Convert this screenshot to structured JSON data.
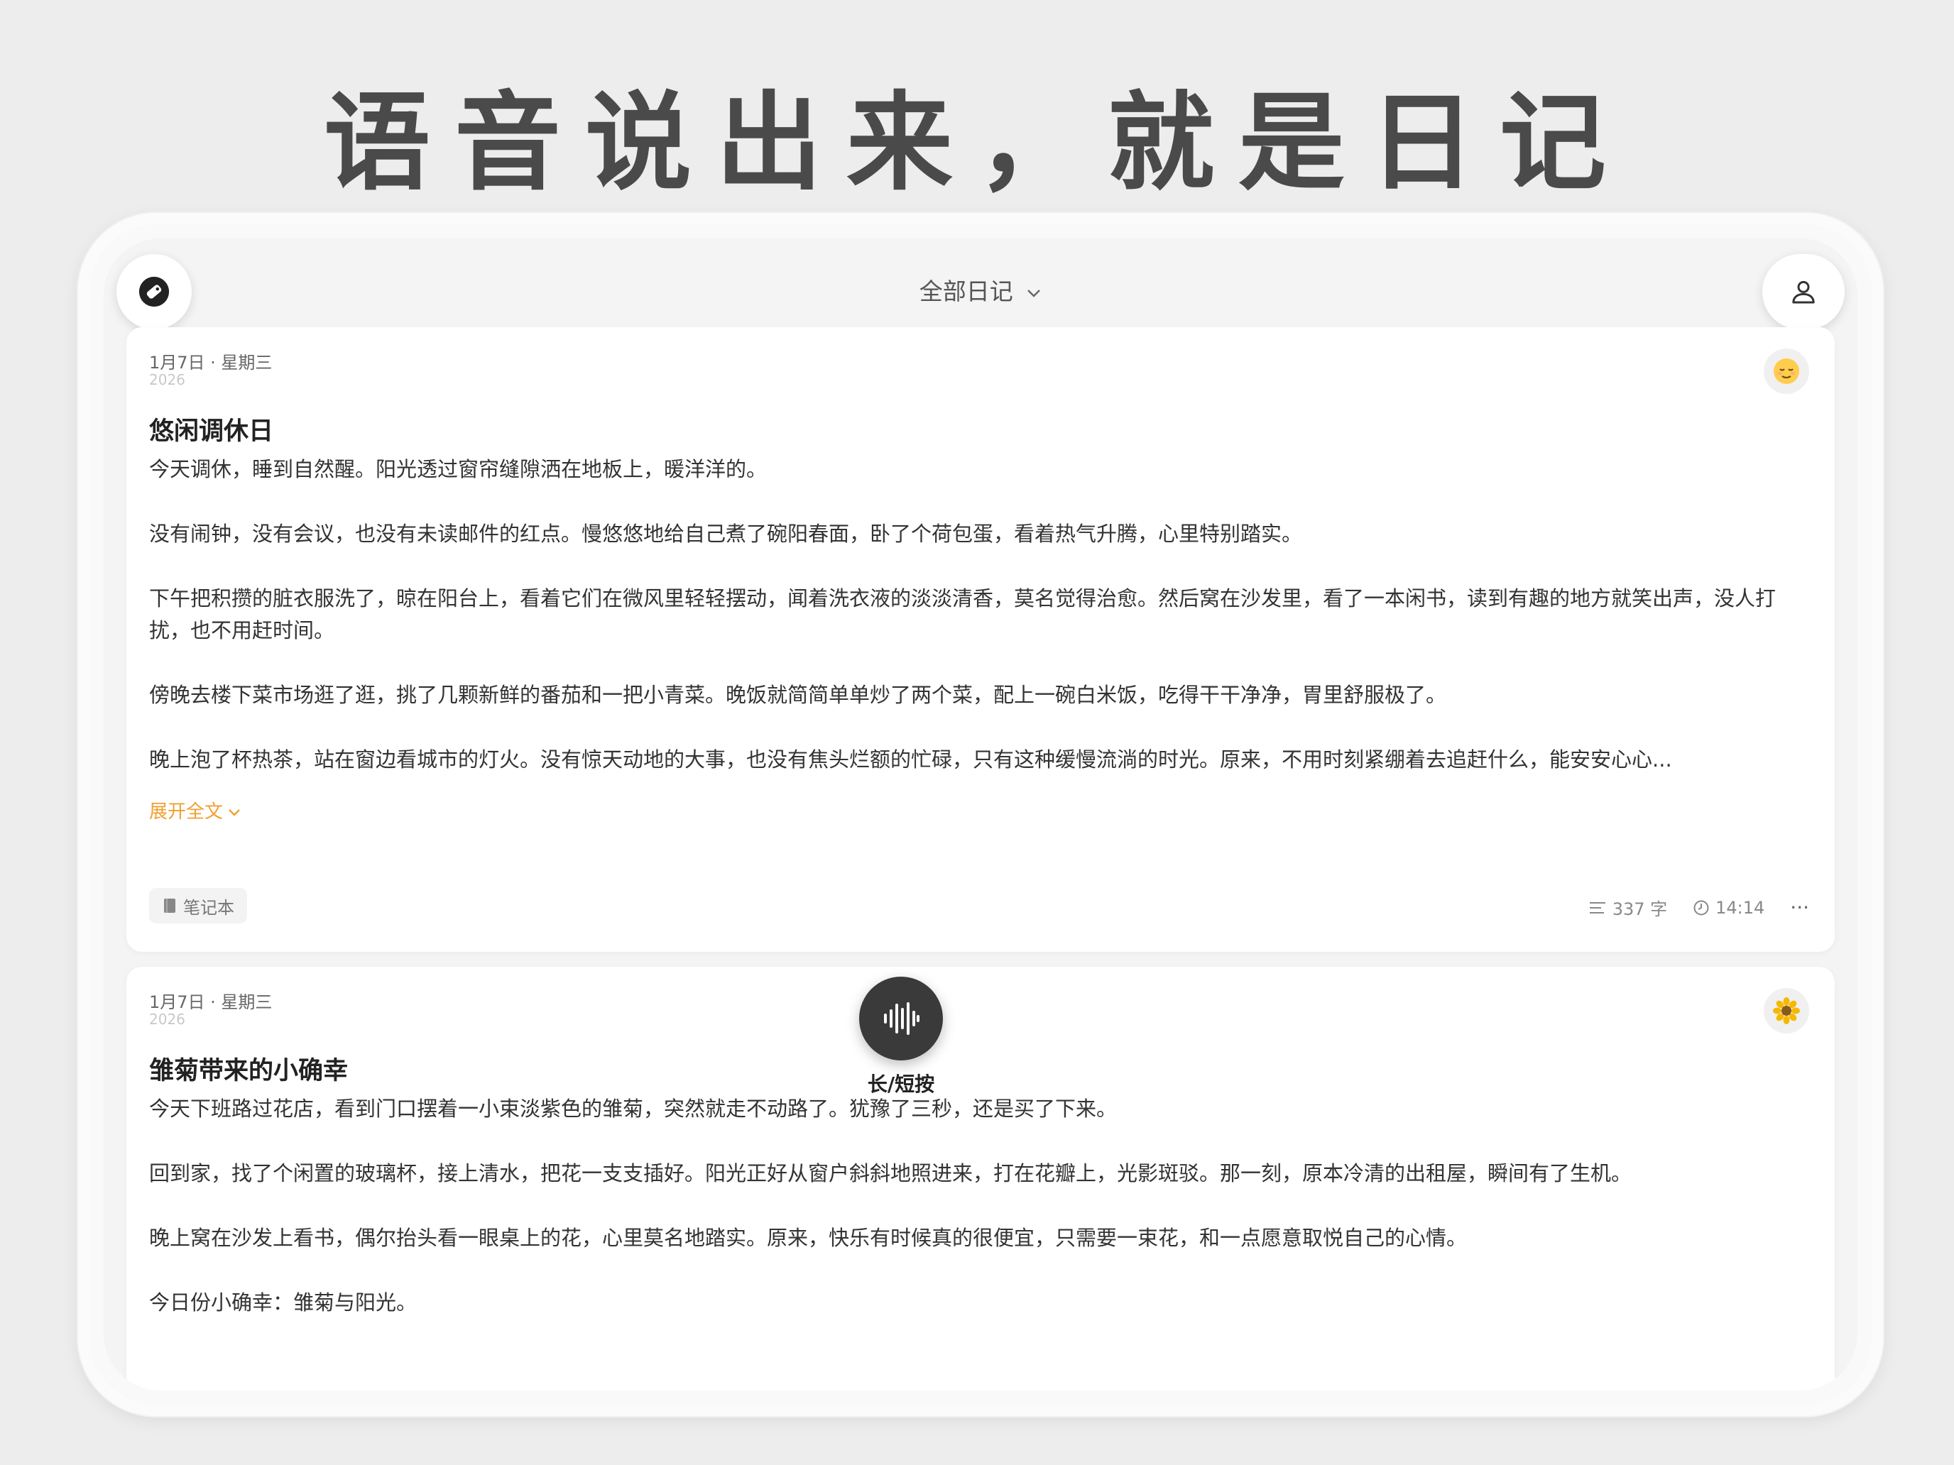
{
  "headline": "语音说出来，就是日记",
  "topbar": {
    "title": "全部日记",
    "tag_icon": "tag-icon",
    "user_icon": "user-icon"
  },
  "entries": [
    {
      "date": "1月7日 · 星期三",
      "year": "2026",
      "mood_icon": "relieved-face-emoji",
      "title": "悠闲调休日",
      "paragraphs": [
        "今天调休，睡到自然醒。阳光透过窗帘缝隙洒在地板上，暖洋洋的。",
        "没有闹钟，没有会议，也没有未读邮件的红点。慢悠悠地给自己煮了碗阳春面，卧了个荷包蛋，看着热气升腾，心里特别踏实。",
        "下午把积攒的脏衣服洗了，晾在阳台上，看着它们在微风里轻轻摆动，闻着洗衣液的淡淡清香，莫名觉得治愈。然后窝在沙发里，看了一本闲书，读到有趣的地方就笑出声，没人打扰，也不用赶时间。",
        "傍晚去楼下菜市场逛了逛，挑了几颗新鲜的番茄和一把小青菜。晚饭就简简单单炒了两个菜，配上一碗白米饭，吃得干干净净，胃里舒服极了。",
        "晚上泡了杯热茶，站在窗边看城市的灯火。没有惊天动地的大事，也没有焦头烂额的忙碌，只有这种缓慢流淌的时光。原来，不用时刻紧绷着去追赶什么，能安安心心..."
      ],
      "expand_label": "展开全文",
      "notebook_label": "笔记本",
      "word_count": "337 字",
      "time": "14:14",
      "more": "···"
    },
    {
      "date": "1月7日 · 星期三",
      "year": "2026",
      "mood_icon": "sunflower-emoji",
      "title": "雏菊带来的小确幸",
      "paragraphs": [
        "今天下班路过花店，看到门口摆着一小束淡紫色的雏菊，突然就走不动路了。犹豫了三秒，还是买了下来。",
        "回到家，找了个闲置的玻璃杯，接上清水，把花一支支插好。阳光正好从窗户斜斜地照进来，打在花瓣上，光影斑驳。那一刻，原本冷清的出租屋，瞬间有了生机。",
        "晚上窝在沙发上看书，偶尔抬头看一眼桌上的花，心里莫名地踏实。原来，快乐有时候真的很便宜，只需要一束花，和一点愿意取悦自己的心情。",
        "今日份小确幸：雏菊与阳光。"
      ]
    }
  ],
  "record": {
    "icon": "voice-waveform-icon",
    "label": "长/短按"
  }
}
